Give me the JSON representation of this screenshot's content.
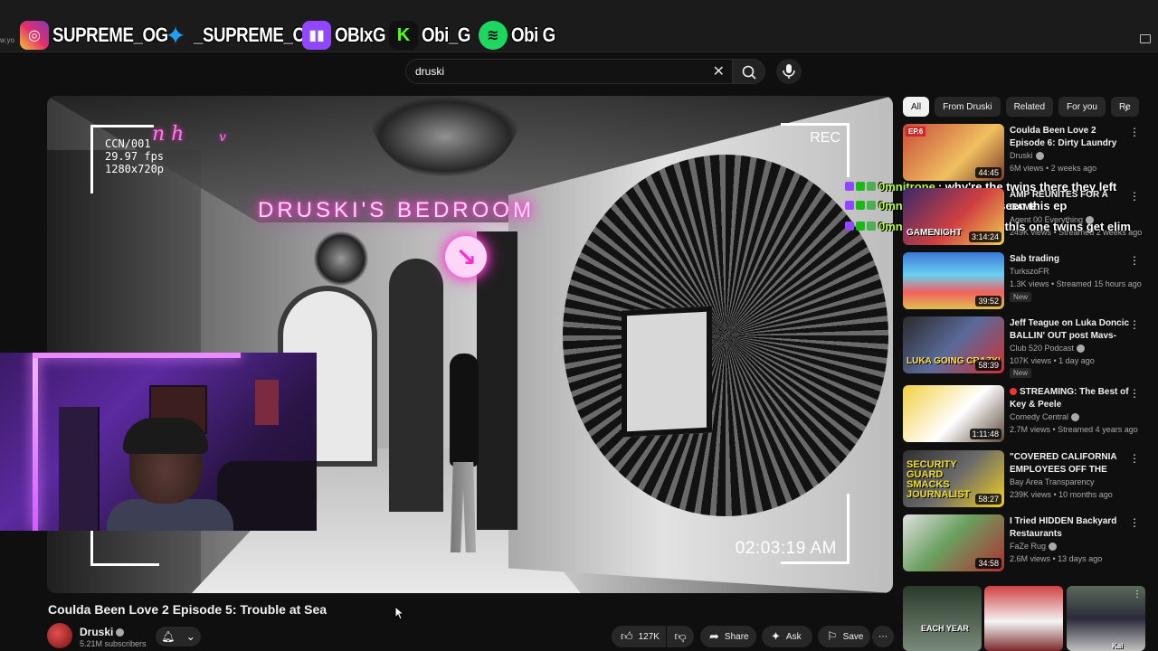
{
  "overlay": {
    "browser_url": "w.yo",
    "socials": [
      {
        "platform": "instagram",
        "handle": "SUPREME_OG",
        "icon": "instagram-icon",
        "color": "#d6249f"
      },
      {
        "platform": "twitter",
        "handle": "_SUPREME_OG",
        "icon": "twitter-icon",
        "color": "#1da1f2"
      },
      {
        "platform": "twitch",
        "handle": "OBIxG",
        "icon": "twitch-icon",
        "color": "#9146ff"
      },
      {
        "platform": "kick",
        "handle": "Obi_G",
        "icon": "kick-icon",
        "color": "#53fc18"
      },
      {
        "platform": "spotify",
        "handle": "Obi G",
        "icon": "spotify-icon",
        "color": "#1ed760"
      }
    ]
  },
  "search": {
    "value": "druski",
    "clear_icon": "close-icon",
    "search_icon": "search-icon",
    "mic_icon": "microphone-icon"
  },
  "video": {
    "title": "Coulda Been Love 2 Episode 5: Trouble at Sea",
    "overlay_title": "DRUSKI'S BEDROOM",
    "rec_info": [
      "CCN/001",
      "29.97 fps",
      "1280x720p"
    ],
    "rec_label": "REC",
    "timestamp": "02:03:19 AM",
    "script_letters": [
      "n h",
      "v"
    ]
  },
  "channel": {
    "name": "Druski",
    "subscribers": "5.21M subscribers"
  },
  "actions": {
    "likes": "127K",
    "share": "Share",
    "ask": "Ask",
    "save": "Save"
  },
  "chips": [
    "All",
    "From Druski",
    "Related",
    "For you",
    "Re"
  ],
  "recommendations": [
    {
      "title": "Coulda Been Love 2 Episode 6: Dirty Laundry",
      "channel": "Druski",
      "verified": true,
      "meta": "6M views • 2 weeks ago",
      "duration": "44:45",
      "thumb_text": "EP.6",
      "colors": [
        "#c84b3a",
        "#f0c060"
      ]
    },
    {
      "title": "AMP REUNITES FOR A GAME",
      "channel": "Agent 00 Everything",
      "verified": true,
      "meta": "249K views • Streamed 2 weeks ago",
      "duration": "3:14:24",
      "thumb_text": "GAMENIGHT",
      "colors": [
        "#3a2a6a",
        "#d04040"
      ]
    },
    {
      "title": "Sab trading",
      "channel": "TurkszoFR",
      "verified": false,
      "meta": "1.3K views • Streamed 15 hours ago",
      "duration": "39:52",
      "badge": "New",
      "colors": [
        "#3a78d8",
        "#f06060"
      ]
    },
    {
      "title": "Jeff Teague on Luka Doncic BALLIN' OUT post Mavs-Laker...",
      "channel": "Club 520 Podcast",
      "verified": true,
      "meta": "107K views • 1 day ago",
      "duration": "58:39",
      "badge": "New",
      "thumb_text": "LUKA GOING CRAZY!",
      "colors": [
        "#2a2a2a",
        "#d03030"
      ]
    },
    {
      "title": "STREAMING: The Best of Key & Peele",
      "channel": "Comedy Central",
      "verified": true,
      "meta": "2.7M views • Streamed 4 years ago",
      "duration": "1:11:48",
      "live_dot": true,
      "colors": [
        "#f2d040",
        "#ffffff"
      ]
    },
    {
      "title": "\"COVERED CALIFORNIA EMPLOYEES OFF THE HOOK!!!...",
      "channel": "Bay Area Transparency",
      "verified": false,
      "meta": "239K views • 10 months ago",
      "duration": "58:27",
      "thumb_text": "SECURITY GUARD SMACKS JOURNALIST",
      "colors": [
        "#f2d020",
        "#303030"
      ]
    },
    {
      "title": "I Tried HIDDEN Backyard Restaurants",
      "channel": "FaZe Rug",
      "verified": true,
      "meta": "2.6M views • 13 days ago",
      "duration": "34:58",
      "colors": [
        "#e0e0e0",
        "#b03030"
      ]
    }
  ],
  "shorts": [
    {
      "text": "EACH YEAR",
      "colors": [
        "#2a3a2a",
        "#7a8a7a"
      ]
    },
    {
      "text": "",
      "colors": [
        "#d04040",
        "#f5f5f5"
      ]
    },
    {
      "text": "Kai",
      "colors": [
        "#2a2a3a",
        "#c0c0c0"
      ]
    }
  ],
  "chat": [
    {
      "user": "0mnitrope",
      "message": ": why're the twins there they left"
    },
    {
      "user": "0mnitrope",
      "message": ": No we've seen this ep"
    },
    {
      "user": "0mnitrope",
      "message": ": the end of this one twins get elim"
    }
  ]
}
